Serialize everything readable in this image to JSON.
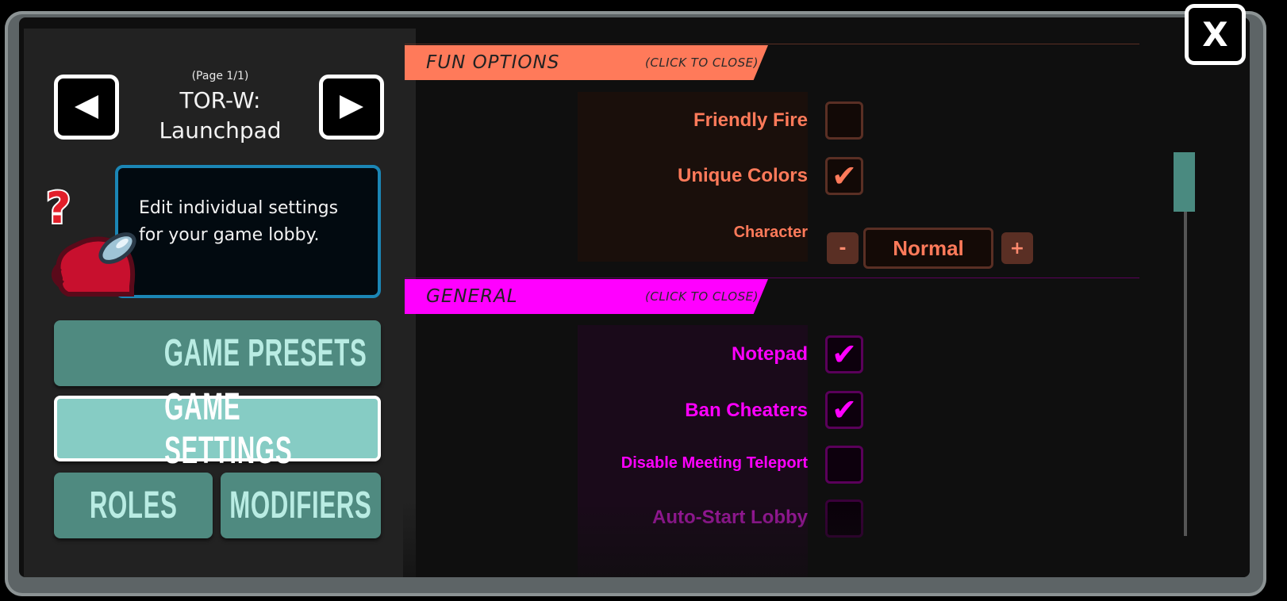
{
  "nav": {
    "prev_icon": "triangle-left",
    "next_icon": "triangle-right",
    "page_indicator": "(Page 1/1)",
    "preset_name": "TOR-W:\nLaunchpad"
  },
  "description": "Edit individual settings for your game lobby.",
  "menu": {
    "presets": "GAME PRESETS",
    "settings": "GAME SETTINGS",
    "roles": "ROLES",
    "modifiers": "MODIFIERS"
  },
  "sections": {
    "fun": {
      "title": "FUN OPTIONS",
      "toggle": "(CLICK TO CLOSE)",
      "color": "#ff7a5a",
      "friendly_fire": {
        "label": "Friendly Fire",
        "checked": false
      },
      "unique_colors": {
        "label": "Unique Colors",
        "checked": true
      },
      "character": {
        "label": "Character",
        "value": "Normal",
        "minus": "-",
        "plus": "+"
      }
    },
    "general": {
      "title": "GENERAL",
      "toggle": "(CLICK TO CLOSE)",
      "color": "#ff00ff",
      "notepad": {
        "label": "Notepad",
        "checked": true
      },
      "ban_cheaters": {
        "label": "Ban Cheaters",
        "checked": true
      },
      "disable_meeting_teleport": {
        "label": "Disable Meeting Teleport",
        "checked": false
      },
      "auto_start_lobby": {
        "label": "Auto-Start Lobby",
        "checked": false
      }
    }
  },
  "close_label": "X",
  "checkmark": "✔"
}
